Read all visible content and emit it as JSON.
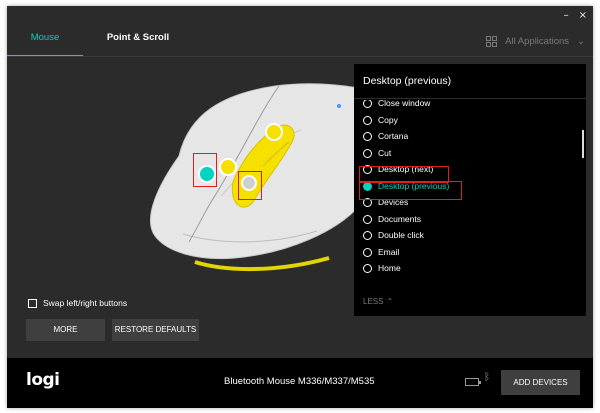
{
  "window": {
    "minimize_label": "–",
    "close_label": "×"
  },
  "tabs": [
    {
      "label": "Mouse",
      "active": true
    },
    {
      "label": "Point & Scroll",
      "active": false
    }
  ],
  "app_selector": {
    "label": "All Applications",
    "icon": "grid-icon",
    "chevron": "⌄"
  },
  "colors": {
    "accent": "#00d3c1",
    "yellow": "#f5e000",
    "highlight_box": "#e11c1c",
    "window_bg": "#2b2b2b"
  },
  "dropdown": {
    "title": "Desktop (previous)",
    "items": [
      {
        "label": "Close window",
        "selected": false
      },
      {
        "label": "Copy",
        "selected": false
      },
      {
        "label": "Cortana",
        "selected": false
      },
      {
        "label": "Cut",
        "selected": false
      },
      {
        "label": "Desktop (next)",
        "selected": false
      },
      {
        "label": "Desktop (previous)",
        "selected": true
      },
      {
        "label": "Devices",
        "selected": false
      },
      {
        "label": "Documents",
        "selected": false
      },
      {
        "label": "Double click",
        "selected": false
      },
      {
        "label": "Email",
        "selected": false
      },
      {
        "label": "Home",
        "selected": false
      }
    ],
    "less_label": "LESS"
  },
  "options": {
    "swap_label": "Swap left/right buttons",
    "swap_checked": false
  },
  "buttons": {
    "more": "MORE",
    "restore": "RESTORE DEFAULTS",
    "add_devices": "ADD DEVICES"
  },
  "footer": {
    "logo": "logi",
    "device_name": "Bluetooth Mouse M336/M337/M535",
    "bluetooth_icon": "ᛒ"
  }
}
